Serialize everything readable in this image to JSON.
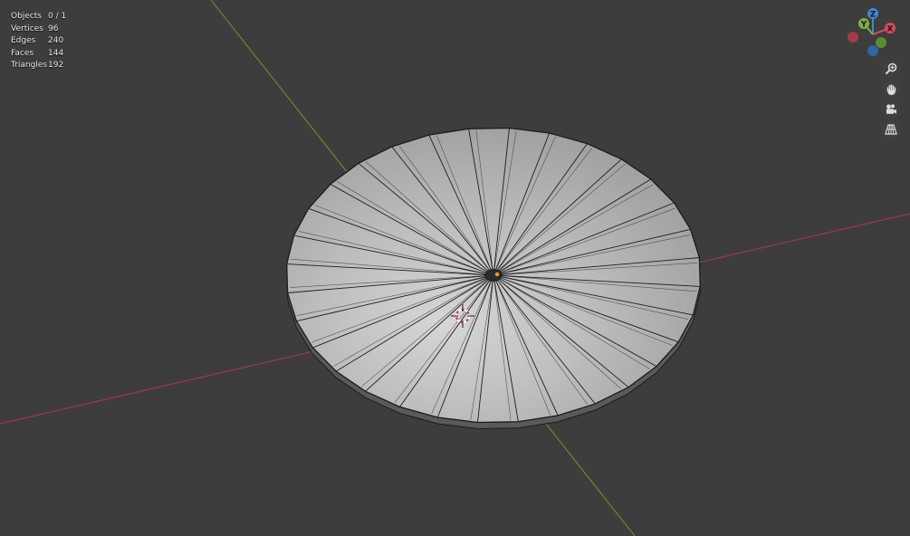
{
  "stats": [
    {
      "label": "Objects",
      "value": "0 / 1"
    },
    {
      "label": "Vertices",
      "value": "96"
    },
    {
      "label": "Edges",
      "value": "240"
    },
    {
      "label": "Faces",
      "value": "144"
    },
    {
      "label": "Triangles",
      "value": "192"
    }
  ],
  "gizmo": {
    "x_label": "X",
    "y_label": "Y",
    "z_label": "Z",
    "x_color": "#d8495b",
    "y_color": "#7ab33c",
    "z_color": "#3f86d9",
    "x_neg_color": "#a83a48",
    "y_neg_color": "#5e8a2e",
    "z_neg_color": "#2f66a8"
  },
  "nav_buttons": [
    {
      "name": "zoom",
      "icon": "magnifier-icon"
    },
    {
      "name": "pan",
      "icon": "hand-icon"
    },
    {
      "name": "camera",
      "icon": "camera-icon"
    },
    {
      "name": "perspective",
      "icon": "grid-perspective-icon"
    }
  ],
  "colors": {
    "background": "#3d3d3d",
    "x_axis_line": "#b23a3f",
    "y_axis_line": "#6a9a22",
    "mesh_face": "#b4b4b4",
    "mesh_edge": "#1c1c1c",
    "origin": "#ff9a1f"
  }
}
